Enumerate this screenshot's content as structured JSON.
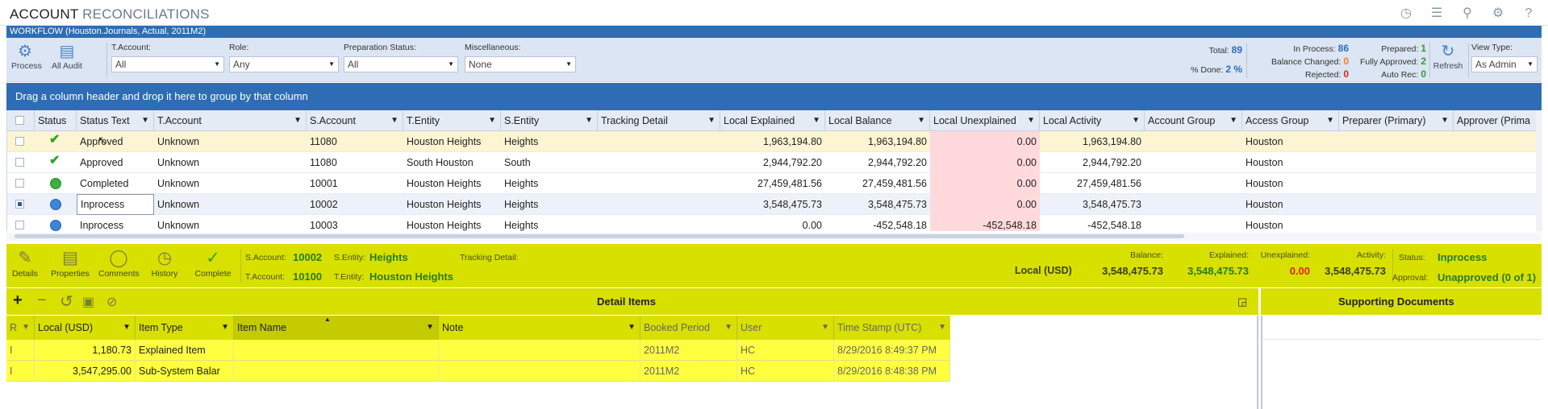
{
  "title": {
    "part1": "ACCOUNT",
    "part2": "RECONCILIATIONS"
  },
  "title_icons": [
    "clock-icon",
    "list-icon",
    "user-icon",
    "gear-icon",
    "help-icon"
  ],
  "workflow": "WORKFLOW  (Houston.Journals, Actual, 2011M2)",
  "toolbar": {
    "process": "Process",
    "all_audit": "All Audit",
    "filters": [
      {
        "label": "T.Account:",
        "value": "All"
      },
      {
        "label": "Role:",
        "value": "Any"
      },
      {
        "label": "Preparation Status:",
        "value": "All"
      },
      {
        "label": "Miscellaneous:",
        "value": "None"
      }
    ],
    "total_label": "Total:",
    "total_value": "89",
    "done_label": "% Done:",
    "done_value": "2 %",
    "inprocess_label": "In Process:",
    "inprocess_value": "86",
    "balchanged_label": "Balance Changed:",
    "balchanged_value": "0",
    "rejected_label": "Rejected:",
    "rejected_value": "0",
    "prepared_label": "Prepared:",
    "prepared_value": "1",
    "fullyapproved_label": "Fully Approved:",
    "fullyapproved_value": "2",
    "autorec_label": "Auto Rec:",
    "autorec_value": "0",
    "refresh": "Refresh",
    "viewtype_label": "View Type:",
    "viewtype_value": "As Admin"
  },
  "groupbar": "Drag a column header and drop it here to group by that column",
  "grid": {
    "headers": [
      "Status",
      "Status Text",
      "T.Account",
      "S.Account",
      "T.Entity",
      "S.Entity",
      "Tracking Detail",
      "Local Explained",
      "Local Balance",
      "Local Unexplained",
      "Local Activity",
      "Account Group",
      "Access Group",
      "Preparer (Primary)",
      "Approver (Prima"
    ],
    "rows": [
      {
        "status": "check",
        "status_text": "Approved",
        "t_account": "Unknown",
        "s_account": "11080",
        "t_entity": "Houston Heights",
        "s_entity": "Heights",
        "tracking": "",
        "explained": "1,963,194.80",
        "balance": "1,963,194.80",
        "unexplained": "0.00",
        "activity": "1,963,194.80",
        "acct_group": "",
        "access_group": "Houston",
        "checked": false
      },
      {
        "status": "check",
        "status_text": "Approved",
        "t_account": "Unknown",
        "s_account": "11080",
        "t_entity": "South Houston",
        "s_entity": "South",
        "tracking": "",
        "explained": "2,944,792.20",
        "balance": "2,944,792.20",
        "unexplained": "0.00",
        "activity": "2,944,792.20",
        "acct_group": "",
        "access_group": "Houston",
        "checked": false
      },
      {
        "status": "green",
        "status_text": "Completed",
        "t_account": "Unknown",
        "s_account": "10001",
        "t_entity": "Houston Heights",
        "s_entity": "Heights",
        "tracking": "",
        "explained": "27,459,481.56",
        "balance": "27,459,481.56",
        "unexplained": "0.00",
        "activity": "27,459,481.56",
        "acct_group": "",
        "access_group": "Houston",
        "checked": false
      },
      {
        "status": "blue",
        "status_text": "Inprocess",
        "t_account": "Unknown",
        "s_account": "10002",
        "t_entity": "Houston Heights",
        "s_entity": "Heights",
        "tracking": "",
        "explained": "3,548,475.73",
        "balance": "3,548,475.73",
        "unexplained": "0.00",
        "activity": "3,548,475.73",
        "acct_group": "",
        "access_group": "Houston",
        "checked": true
      },
      {
        "status": "blue",
        "status_text": "Inprocess",
        "t_account": "Unknown",
        "s_account": "10003",
        "t_entity": "Houston Heights",
        "s_entity": "Heights",
        "tracking": "",
        "explained": "0.00",
        "balance": "-452,548.18",
        "unexplained": "-452,548.18",
        "activity": "-452,548.18",
        "acct_group": "",
        "access_group": "Houston",
        "checked": false
      }
    ]
  },
  "detail": {
    "buttons": [
      "Details",
      "Properties",
      "Comments",
      "History",
      "Complete"
    ],
    "s_account_label": "S.Account:",
    "s_account": "10002",
    "s_entity_label": "S.Entity:",
    "s_entity": "Heights",
    "tracking_label": "Tracking Detail:",
    "t_account_label": "T.Account:",
    "t_account": "10100",
    "t_entity_label": "T.Entity:",
    "t_entity": "Houston Heights",
    "local_label": "Local (USD)",
    "balance_label": "Balance:",
    "balance": "3,548,475.73",
    "explained_label": "Explained:",
    "explained": "3,548,475.73",
    "unexplained_label": "Unexplained:",
    "unexplained": "0.00",
    "activity_label": "Activity:",
    "activity": "3,548,475.73",
    "status_label": "Status:",
    "status": "Inprocess",
    "approval_label": "Approval:",
    "approval": "Unapproved (0 of 1)"
  },
  "detail_items": {
    "title": "Detail Items",
    "headers": [
      "R",
      "Local (USD)",
      "Item Type",
      "Item Name",
      "Note",
      "Booked Period",
      "User",
      "Time Stamp (UTC)"
    ],
    "rows": [
      {
        "r": "I",
        "local": "1,180.73",
        "type": "Explained Item",
        "name": "",
        "note": "",
        "period": "2011M2",
        "user": "HC",
        "ts": "8/29/2016 8:49:37 PM"
      },
      {
        "r": "I",
        "local": "3,547,295.00",
        "type": "Sub-System Balar",
        "name": "",
        "note": "",
        "period": "2011M2",
        "user": "HC",
        "ts": "8/29/2016 8:48:38 PM"
      }
    ]
  },
  "supporting": {
    "title": "Supporting Documents"
  }
}
